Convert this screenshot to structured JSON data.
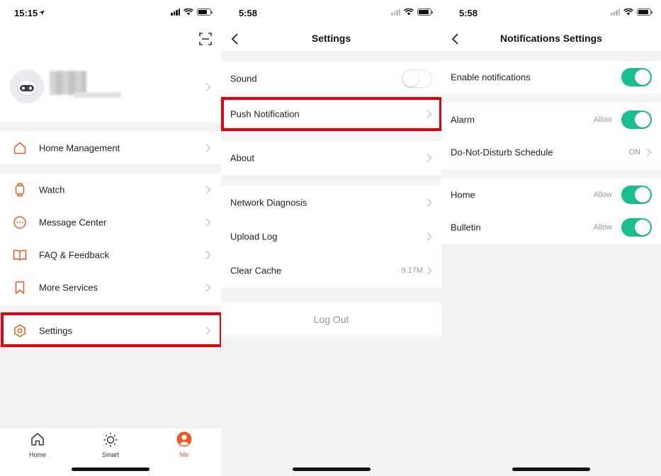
{
  "colors": {
    "accent": "#f05a22",
    "toggle_on": "#16c08f",
    "highlight": "#e8000b"
  },
  "screen1": {
    "status": {
      "time": "15:15"
    },
    "menu": [
      {
        "label": "Home Management",
        "icon": "house-icon"
      },
      {
        "label": "Watch",
        "icon": "watch-icon"
      },
      {
        "label": "Message Center",
        "icon": "message-icon"
      },
      {
        "label": "FAQ & Feedback",
        "icon": "book-icon"
      },
      {
        "label": "More Services",
        "icon": "bookmark-icon"
      },
      {
        "label": "Settings",
        "icon": "hexagon-gear-icon"
      }
    ],
    "tabs": [
      {
        "label": "Home",
        "icon": "home-tab-icon"
      },
      {
        "label": "Smart",
        "icon": "sun-icon"
      },
      {
        "label": "Me",
        "icon": "person-icon",
        "active": true
      }
    ]
  },
  "screen2": {
    "status": {
      "time": "5:58"
    },
    "title": "Settings",
    "rows": {
      "sound": {
        "label": "Sound",
        "toggle": false
      },
      "push": {
        "label": "Push Notification"
      },
      "about": {
        "label": "About"
      },
      "network": {
        "label": "Network Diagnosis"
      },
      "upload": {
        "label": "Upload Log"
      },
      "cache": {
        "label": "Clear Cache",
        "value": "9.17M"
      }
    },
    "logout": "Log Out"
  },
  "screen3": {
    "status": {
      "time": "5:58"
    },
    "title": "Notifications Settings",
    "rows": {
      "enable": {
        "label": "Enable notifications",
        "toggle": true
      },
      "alarm": {
        "label": "Alarm",
        "value": "Allow",
        "toggle": true
      },
      "dnd": {
        "label": "Do-Not-Disturb Schedule",
        "value": "ON"
      },
      "home": {
        "label": "Home",
        "value": "Allow",
        "toggle": true
      },
      "bulletin": {
        "label": "Bulletin",
        "value": "Allow",
        "toggle": true
      }
    }
  }
}
